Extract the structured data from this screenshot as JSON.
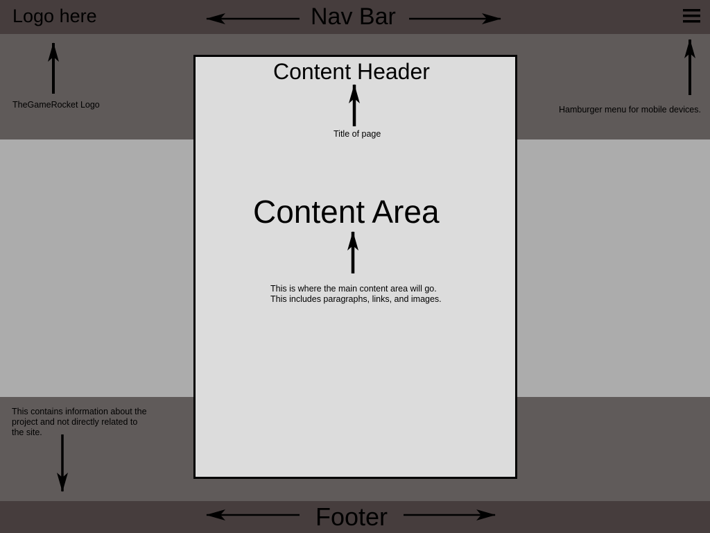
{
  "navbar": {
    "logo_text": "Logo here",
    "title": "Nav Bar"
  },
  "annotations": {
    "logo_note": "TheGameRocket Logo",
    "hamburger_note": "Hamburger menu for mobile devices.",
    "title_note": "Title of page",
    "content_note": "This is where the main content area will go.\nThis includes paragraphs, links, and images.",
    "footer_note": "This contains information about the\nproject and not directly related to\nthe site."
  },
  "content": {
    "header": "Content Header",
    "area_title": "Content Area"
  },
  "footer": {
    "title": "Footer"
  },
  "icons": {
    "menu": "hamburger-menu-icon"
  },
  "colors": {
    "navbar_bg": "#463d3d",
    "header_band_bg": "#5f5a59",
    "mid_band_bg": "#acacac",
    "footer_info_bg": "#605b5a",
    "content_panel_bg": "#dcdcdc"
  }
}
